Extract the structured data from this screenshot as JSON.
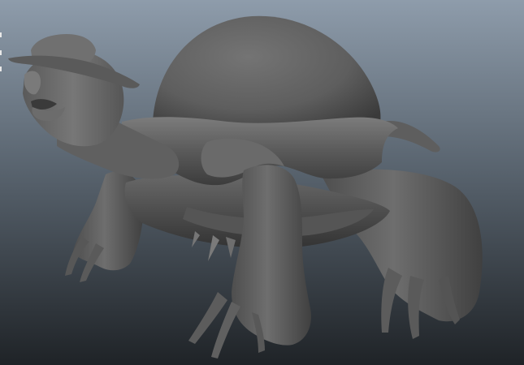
{
  "viewport": {
    "background_top": "#8e9cab",
    "background_mid": "#5a6570",
    "background_bottom": "#1f2327",
    "model_base_color": "#666666",
    "model_highlight": "#8a8a8a",
    "model_shadow": "#2e2e2e"
  },
  "model": {
    "name": "tortoise-with-hat",
    "parts": [
      "shell-dome",
      "shell-rim",
      "head",
      "hat",
      "neck",
      "front-left-leg",
      "front-right-leg",
      "back-left-leg",
      "back-right-leg",
      "tail",
      "belly-plate"
    ]
  }
}
